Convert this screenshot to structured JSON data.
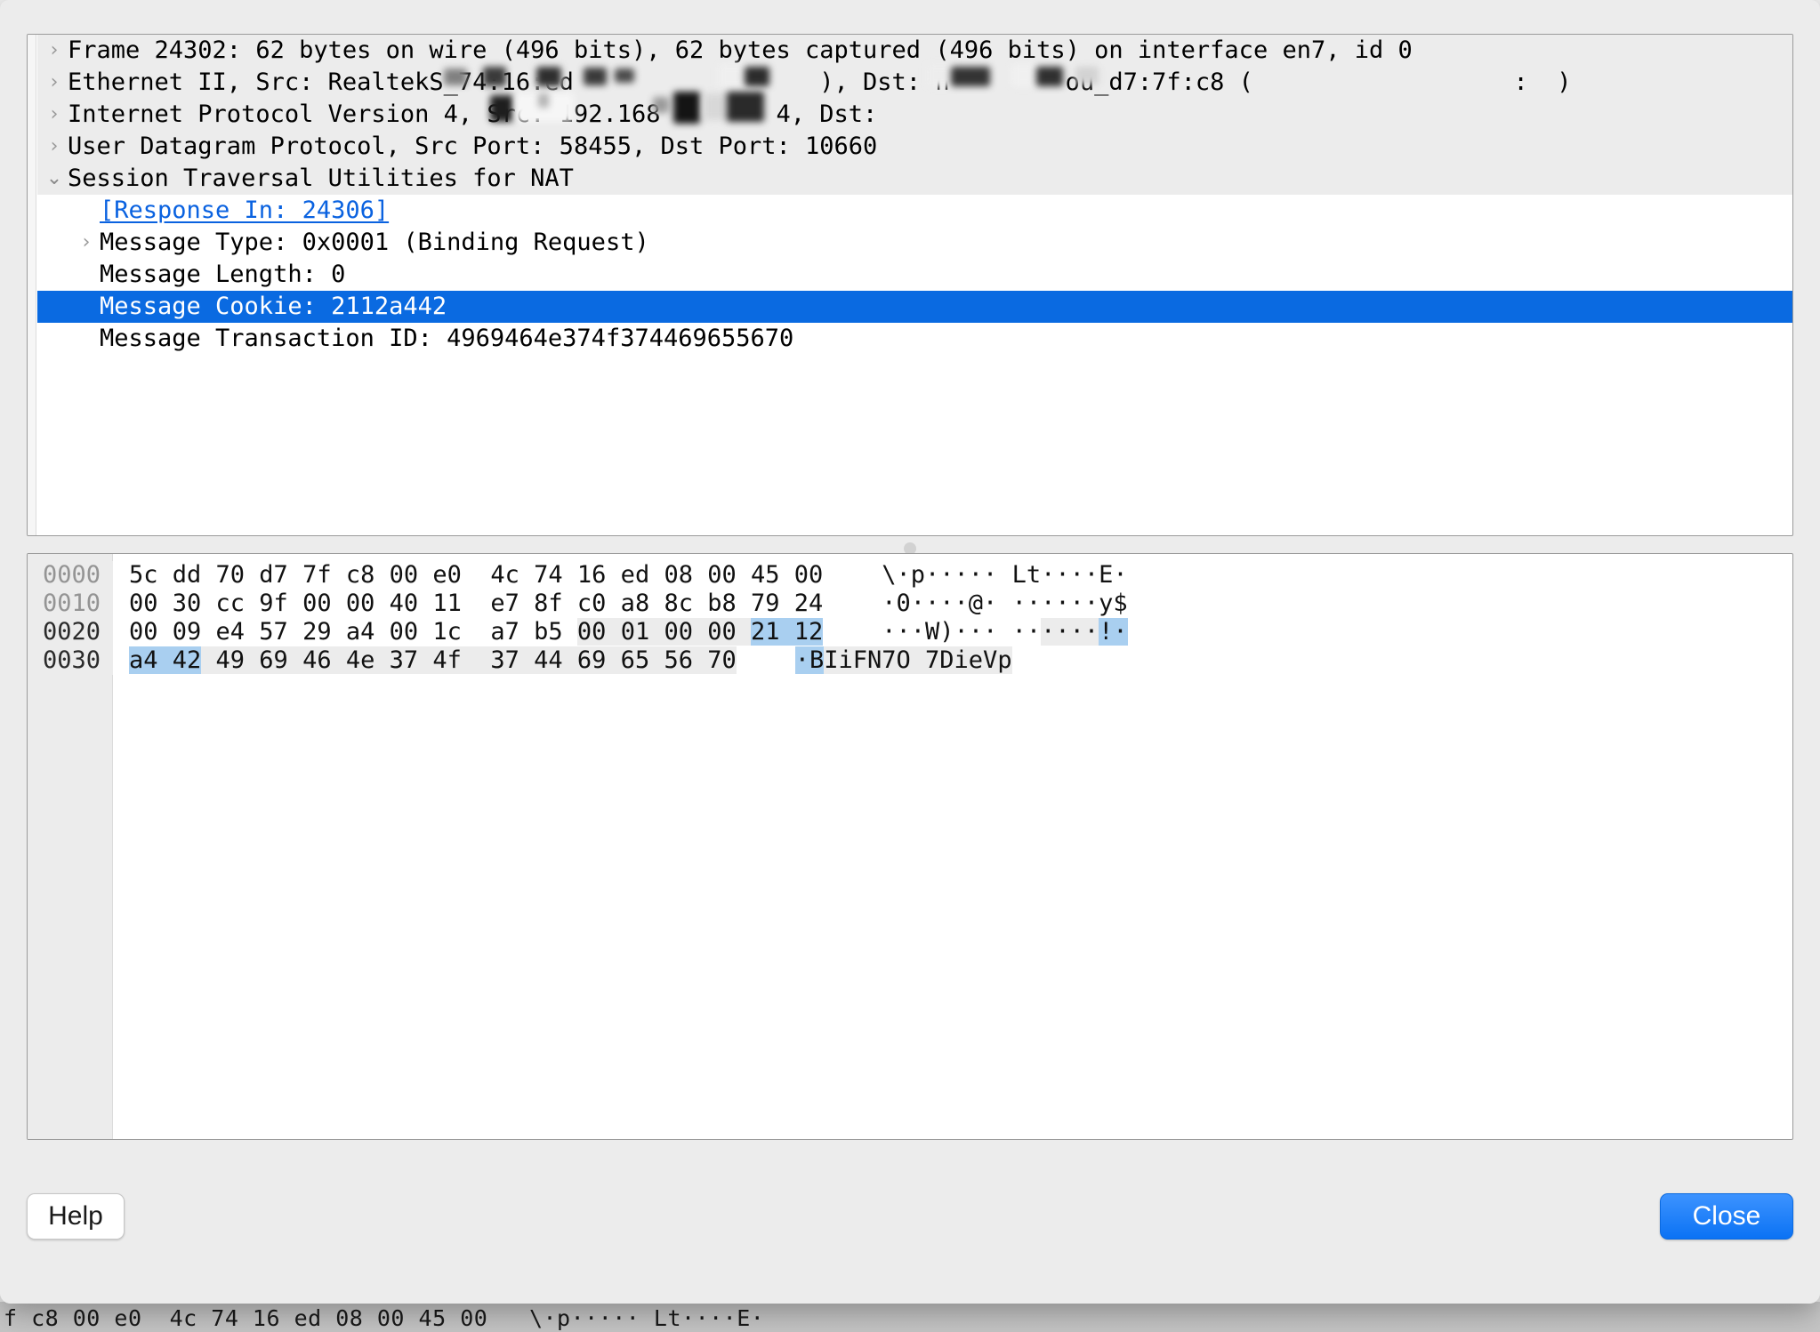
{
  "detail_tree": [
    {
      "twisty": "collapsed",
      "indent": 0,
      "shaded": true,
      "text": "Frame 24302: 62 bytes on wire (496 bits), 62 bytes captured (496 bits) on interface en7, id 0"
    },
    {
      "twisty": "collapsed",
      "indent": 0,
      "shaded": true,
      "text": "Ethernet II, Src: RealtekS_74:16:ed                 ), Dst: h        ou_d7:7f:c8 (                  :  )"
    },
    {
      "twisty": "collapsed",
      "indent": 0,
      "shaded": true,
      "text": "Internet Protocol Version 4, Src: 192.168        4, Dst:           "
    },
    {
      "twisty": "collapsed",
      "indent": 0,
      "shaded": true,
      "text": "User Datagram Protocol, Src Port: 58455, Dst Port: 10660"
    },
    {
      "twisty": "expanded",
      "indent": 0,
      "shaded": true,
      "text": "Session Traversal Utilities for NAT"
    },
    {
      "twisty": "none",
      "indent": 1,
      "shaded": false,
      "link": true,
      "text": "[Response In: 24306]"
    },
    {
      "twisty": "collapsed",
      "indent": 1,
      "shaded": false,
      "text": "Message Type: 0x0001 (Binding Request)"
    },
    {
      "twisty": "none",
      "indent": 1,
      "shaded": false,
      "text": "Message Length: 0"
    },
    {
      "twisty": "none",
      "indent": 1,
      "shaded": false,
      "selected": true,
      "text": "Message Cookie: 2112a442"
    },
    {
      "twisty": "none",
      "indent": 1,
      "shaded": false,
      "text": "Message Transaction ID: 4969464e374f374469655670"
    }
  ],
  "hex_dump": {
    "rows": [
      {
        "offset": "0000",
        "offset_dim": true,
        "bytes_segments": [
          {
            "text": "5c dd 70 d7 7f c8 00 e0  4c 74 16 ed 08 00 45 00",
            "hl": "none"
          }
        ],
        "ascii_segments": [
          {
            "text": "\\·p····· Lt····E·",
            "hl": "none"
          }
        ]
      },
      {
        "offset": "0010",
        "offset_dim": true,
        "bytes_segments": [
          {
            "text": "00 30 cc 9f 00 00 40 11  e7 8f c0 a8 8c b8 79 24",
            "hl": "none"
          }
        ],
        "ascii_segments": [
          {
            "text": "·0····@· ······y$",
            "hl": "none"
          }
        ]
      },
      {
        "offset": "0020",
        "offset_dim": false,
        "bytes_segments": [
          {
            "text": "00 09 e4 57 29 a4 00 1c  a7 b5 ",
            "hl": "none"
          },
          {
            "text": "00 01 00 00 ",
            "hl": "gray"
          },
          {
            "text": "21 12",
            "hl": "blue"
          }
        ],
        "ascii_segments": [
          {
            "text": "···W)··· ··",
            "hl": "none"
          },
          {
            "text": "····",
            "hl": "gray"
          },
          {
            "text": "!·",
            "hl": "blue"
          }
        ]
      },
      {
        "offset": "0030",
        "offset_dim": false,
        "bytes_segments": [
          {
            "text": "a4 42",
            "hl": "blue"
          },
          {
            "text": " 49 69 46 4e 37 4f  37 44 69 65 56 70",
            "hl": "gray"
          }
        ],
        "ascii_segments": [
          {
            "text": "·B",
            "hl": "blue"
          },
          {
            "text": "IiFN7O 7DieVp",
            "hl": "gray"
          }
        ]
      }
    ]
  },
  "buttons": {
    "help_label": "Help",
    "close_label": "Close"
  },
  "background_window": {
    "hex_line": "f c8 00 e0  4c 74 16 ed 08 00 45 00   \\·p····· Lt····E·"
  },
  "colors": {
    "selection_blue": "#0a6ae1",
    "link_blue": "#0a62e0",
    "hex_highlight_blue": "#a9cff0",
    "hex_highlight_gray": "#ececec",
    "window_chrome": "#ececec",
    "default_button_blue": "#0b72f4"
  }
}
